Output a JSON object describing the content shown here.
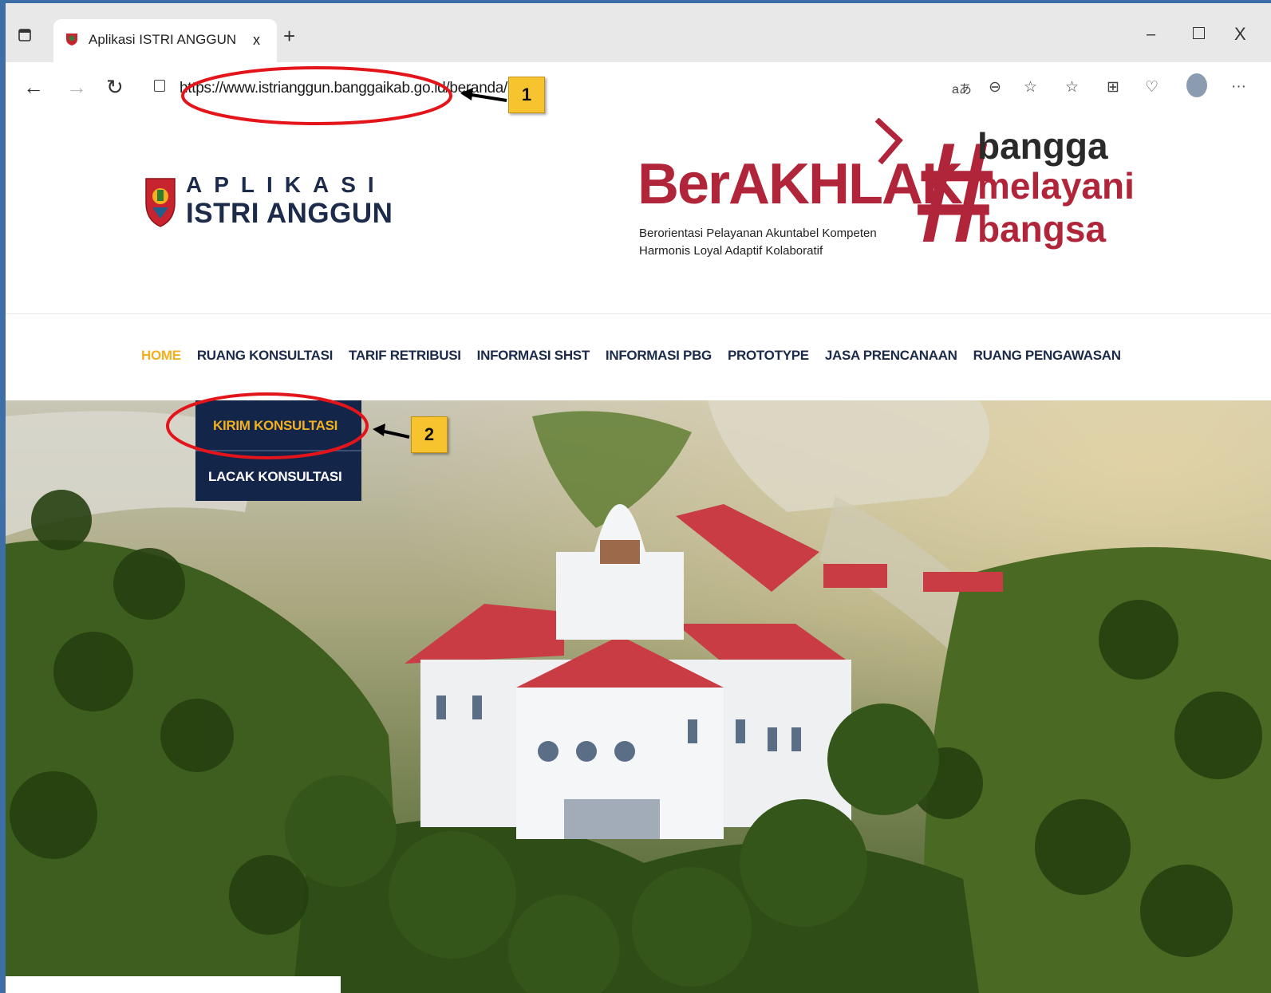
{
  "browser": {
    "tab_title": "Aplikasi ISTRI ANGGUN",
    "tab_close": "x",
    "new_tab": "+",
    "window_min": "–",
    "window_close": "X",
    "url": "https://www.istrianggun.banggaikab.go.id/beranda/index",
    "read_aloud": "aあ",
    "more": "···"
  },
  "header": {
    "logo_top": "APLIKASI",
    "logo_bottom": "ISTRI ANGGUN",
    "berakhlak": "BerAKHLAK",
    "berakhlak_line1": "Berorientasi Pelayanan Akuntabel Kompeten",
    "berakhlak_line2": "Harmonis Loyal Adaptif Kolaboratif",
    "hash": "#",
    "slogan_1": "bangga",
    "slogan_2": "melayani",
    "slogan_3": "bangsa"
  },
  "menu": {
    "items": [
      {
        "label": "HOME",
        "active": true
      },
      {
        "label": "RUANG KONSULTASI",
        "active": false
      },
      {
        "label": "TARIF RETRIBUSI",
        "active": false
      },
      {
        "label": "INFORMASI SHST",
        "active": false
      },
      {
        "label": "INFORMASI PBG",
        "active": false
      },
      {
        "label": "PROTOTYPE",
        "active": false
      },
      {
        "label": "JASA PRENCANAAN",
        "active": false
      },
      {
        "label": "RUANG PENGAWASAN",
        "active": false
      }
    ]
  },
  "dropdown": {
    "kirim": "KIRIM KONSULTASI",
    "lacak": "LACAK KONSULTASI"
  },
  "annotations": {
    "badge_1": "1",
    "badge_2": "2"
  },
  "colors": {
    "navy": "#13264a",
    "accent_yellow": "#f2b01e",
    "brand_red": "#b1253a",
    "annotation_red": "#e4141b"
  }
}
